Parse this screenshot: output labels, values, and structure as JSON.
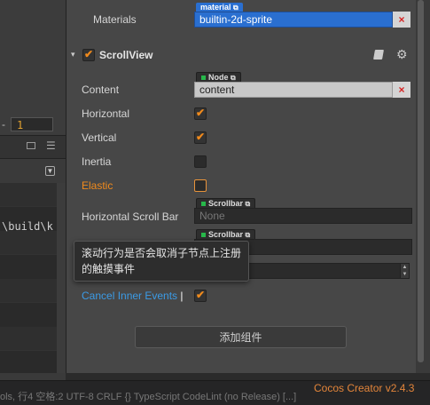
{
  "left": {
    "number_value": "1",
    "minus": "-",
    "console_line": "\\build\\k"
  },
  "inspector": {
    "materials": {
      "label": "Materials",
      "tag": "material",
      "value": "builtin-2d-sprite",
      "clear": "×"
    },
    "section": {
      "title": "ScrollView",
      "arrow": "▾"
    },
    "content": {
      "label": "Content",
      "tag": "Node",
      "value": "content",
      "clear": "×"
    },
    "horizontal": {
      "label": "Horizontal",
      "checked": true
    },
    "vertical": {
      "label": "Vertical",
      "checked": true
    },
    "inertia": {
      "label": "Inertia",
      "checked": false
    },
    "elastic": {
      "label": "Elastic",
      "checked": false
    },
    "h_scrollbar": {
      "label": "Horizontal Scroll Bar",
      "tag": "Scrollbar",
      "value": "None"
    },
    "v_scrollbar": {
      "tag": "Scrollbar"
    },
    "cancel_inner": {
      "label": "Cancel Inner Events",
      "checked": true
    },
    "add_component": "添加组件"
  },
  "tooltip": "滚动行为是否会取消子节点上注册的触摸事件",
  "statusbar": {
    "text": "ols, 行4    空格:2    UTF-8    CRLF    {} TypeScript    CodeLint (no Release) [...]",
    "version": "Cocos Creator v2.4.3"
  },
  "colors": {
    "accent": "#f08a1c",
    "blue": "#2a6fd0",
    "link": "#3b9be6"
  }
}
